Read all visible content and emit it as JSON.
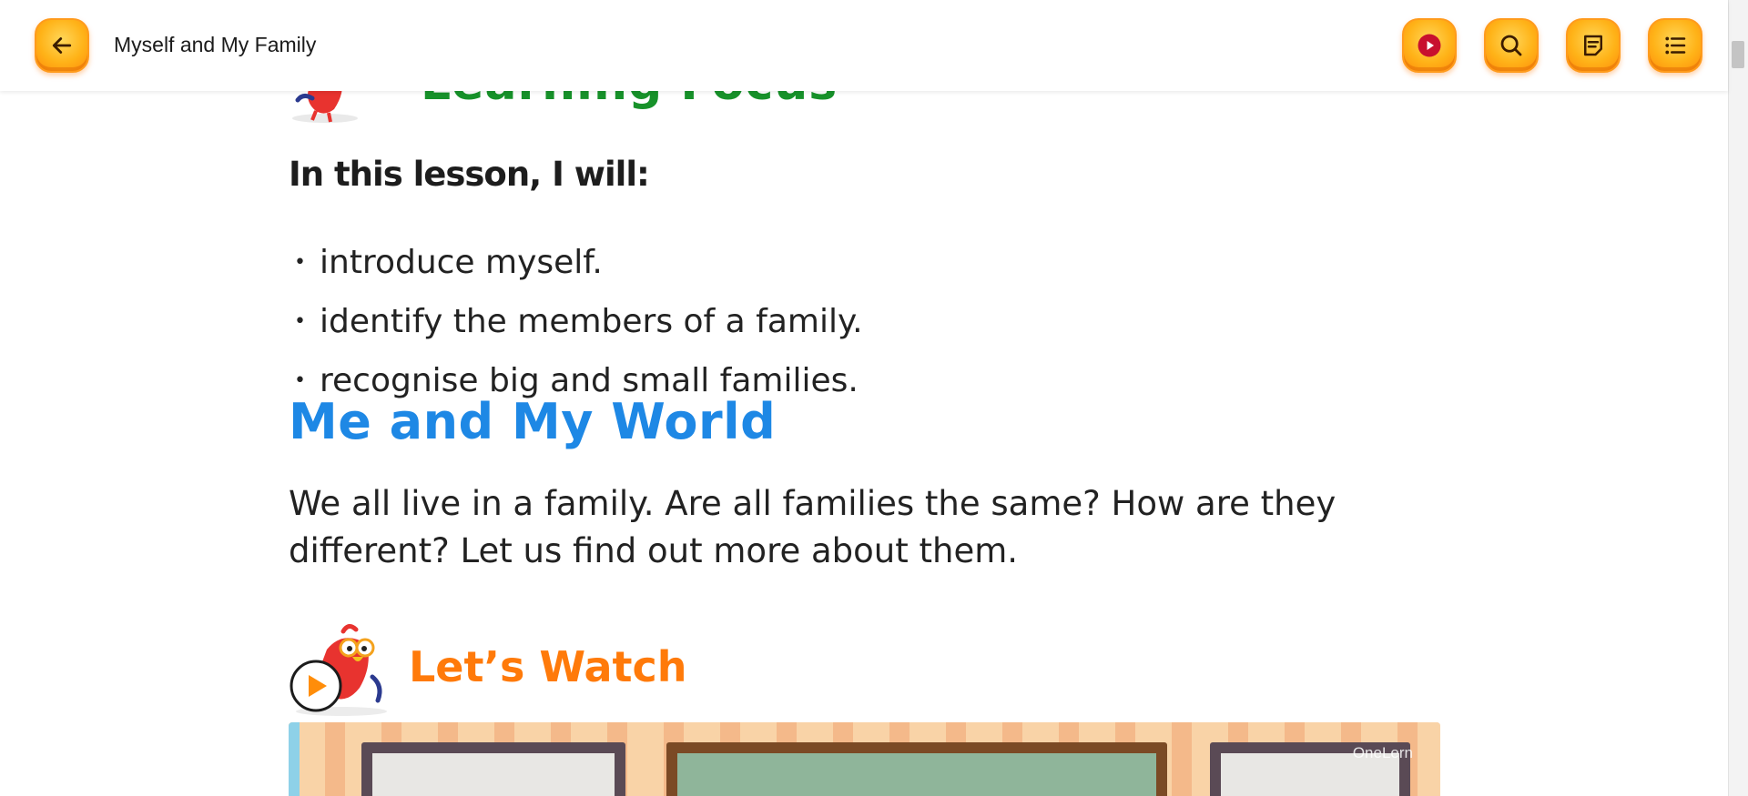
{
  "header": {
    "title": "Myself and My Family",
    "back_icon": "arrow-left-icon",
    "actions": [
      {
        "name": "play-button",
        "icon": "play-icon"
      },
      {
        "name": "search-button",
        "icon": "search-icon"
      },
      {
        "name": "notes-button",
        "icon": "notes-icon"
      },
      {
        "name": "contents-button",
        "icon": "list-icon"
      }
    ]
  },
  "focus_section": {
    "heading": "Learning Focus",
    "intro": "In this lesson, I will:",
    "goals": [
      "introduce myself.",
      "identify the members of a family.",
      "recognise big and small families."
    ]
  },
  "world_section": {
    "heading": "Me and My World",
    "text": "We all live in a family. Are all families the same? How are they different? Let us find out more about them."
  },
  "watch_section": {
    "heading": "Let’s Watch",
    "video_watermark": "OneLern"
  },
  "colors": {
    "accent_orange": "#ff8d0a",
    "focus_green": "#17922a",
    "world_blue": "#1e88e5",
    "watch_orange": "#ff7a0a"
  }
}
